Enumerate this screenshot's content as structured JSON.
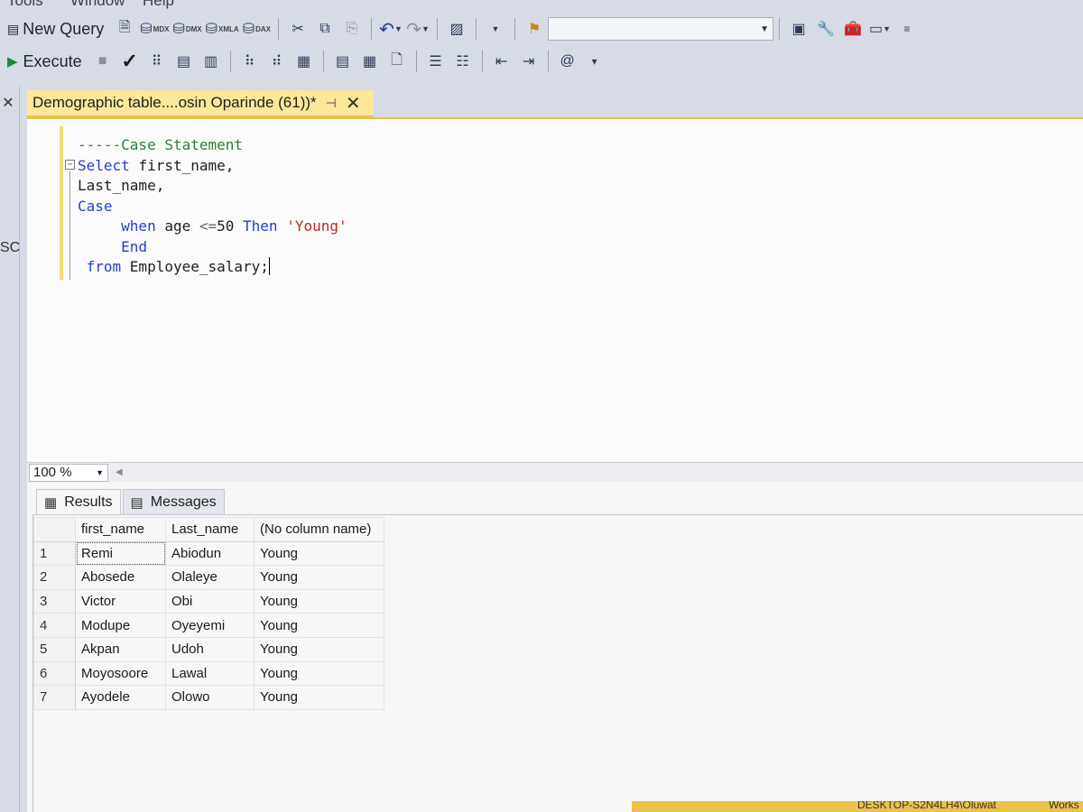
{
  "menu": {
    "items": [
      "Tools",
      "Window",
      "Help"
    ]
  },
  "toolbar1": {
    "new_query": "New Query",
    "mdx": "MDX",
    "dmx": "DMX",
    "xmla": "XMLA",
    "dax": "DAX"
  },
  "toolbar2": {
    "execute": "Execute"
  },
  "left_dock": {
    "label": "SC"
  },
  "tab": {
    "title": "Demographic table....osin Oparinde (61))*"
  },
  "editor": {
    "lines": [
      {
        "parts": [
          {
            "t": "-----Case Statement",
            "c": "cm"
          }
        ]
      },
      {
        "parts": [
          {
            "t": "Select ",
            "c": "kw"
          },
          {
            "t": "first_name,",
            "c": "id"
          }
        ]
      },
      {
        "parts": [
          {
            "t": "Last_name,",
            "c": "id"
          }
        ]
      },
      {
        "parts": [
          {
            "t": "Case",
            "c": "kw"
          }
        ]
      },
      {
        "parts": [
          {
            "t": "     when ",
            "c": "kw"
          },
          {
            "t": "age ",
            "c": "id"
          },
          {
            "t": "<=",
            "c": "op"
          },
          {
            "t": "50 ",
            "c": "id"
          },
          {
            "t": "Then ",
            "c": "kw"
          },
          {
            "t": "'Young'",
            "c": "str"
          }
        ]
      },
      {
        "parts": [
          {
            "t": "     End",
            "c": "kw"
          }
        ]
      },
      {
        "parts": [
          {
            "t": " from ",
            "c": "kw"
          },
          {
            "t": "Employee_salary;",
            "c": "id"
          }
        ]
      }
    ]
  },
  "zoom": {
    "value": "100 %"
  },
  "results": {
    "tabs": [
      "Results",
      "Messages"
    ],
    "columns": [
      "first_name",
      "Last_name",
      "(No column name)"
    ],
    "rows": [
      [
        "1",
        "Remi",
        "Abiodun",
        "Young"
      ],
      [
        "2",
        "Abosede",
        "Olaleye",
        "Young"
      ],
      [
        "3",
        "Victor",
        "Obi",
        "Young"
      ],
      [
        "4",
        "Modupe",
        "Oyeyemi",
        "Young"
      ],
      [
        "5",
        "Akpan",
        "Udoh",
        "Young"
      ],
      [
        "6",
        "Moyosoore",
        "Lawal",
        "Young"
      ],
      [
        "7",
        "Ayodele",
        "Olowo",
        "Young"
      ]
    ]
  },
  "statusbar": {
    "server": "DESKTOP-S2N4LH4\\Oluwat",
    "db": "Works"
  },
  "colors": {
    "tab_accent": "#fce79a",
    "keyword": "#1f3fd0",
    "comment": "#2f7d32",
    "string": "#c0291e"
  }
}
